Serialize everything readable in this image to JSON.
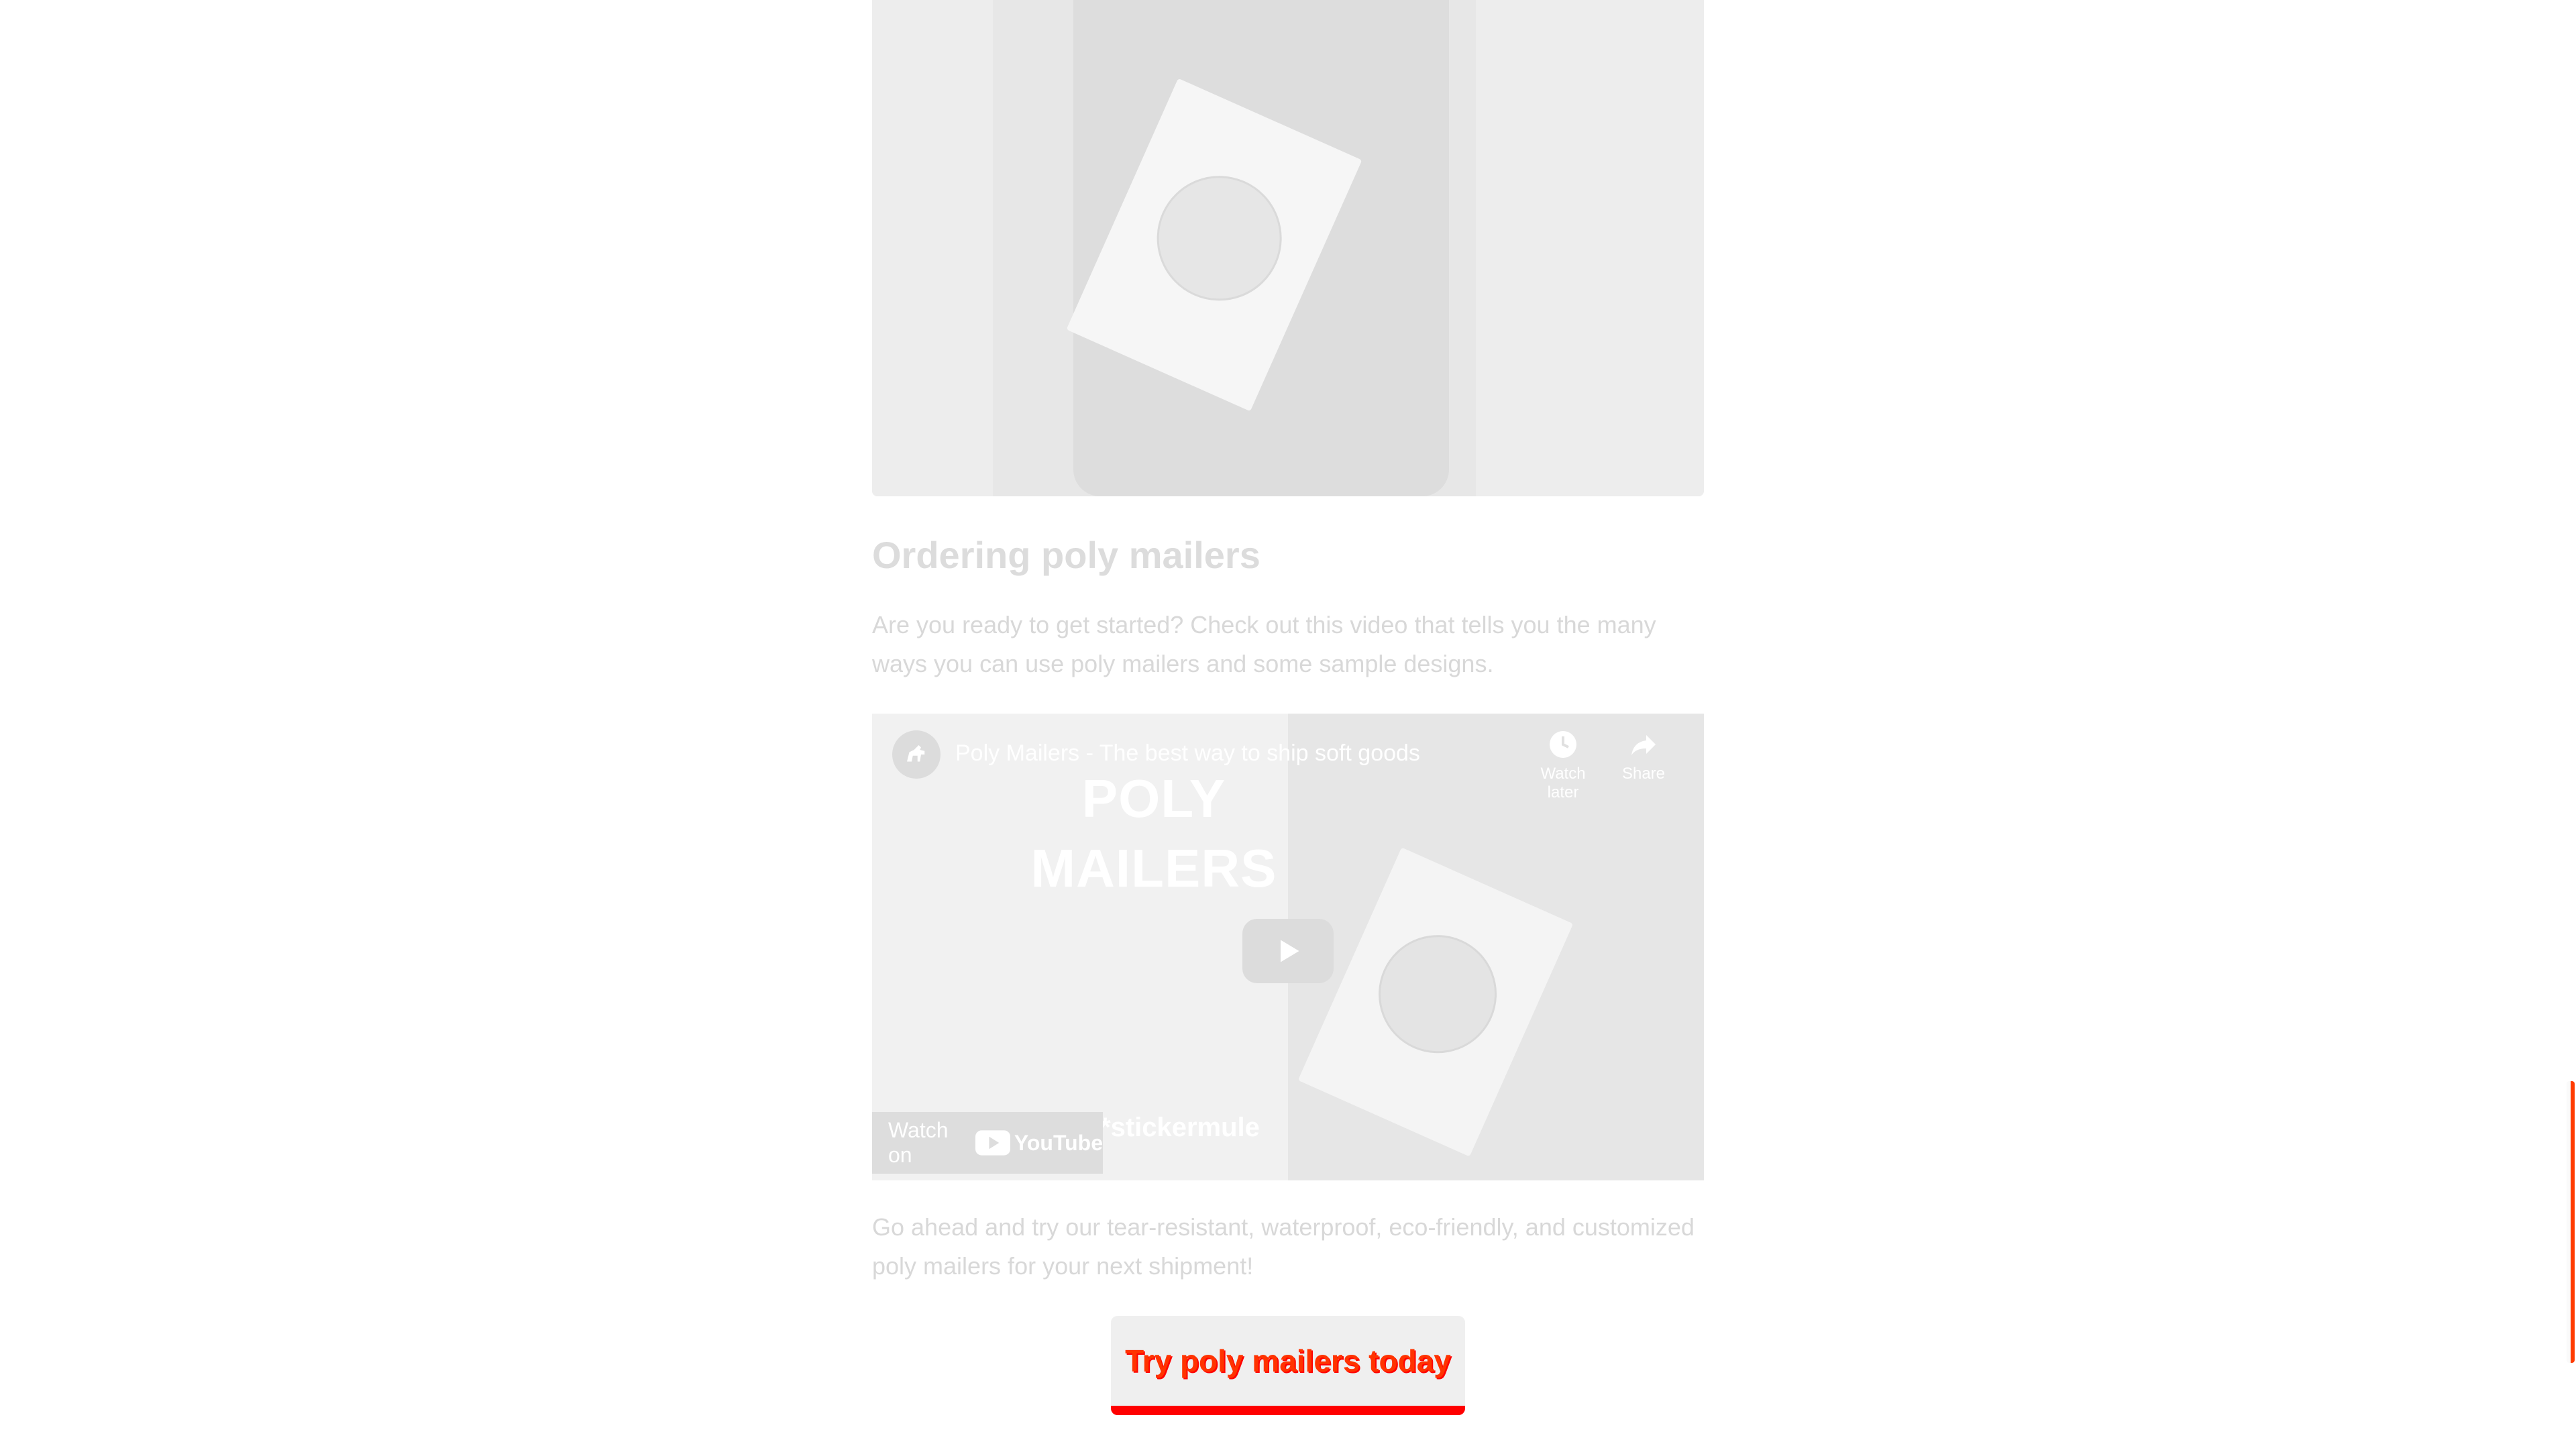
{
  "article": {
    "heading": "Ordering poly mailers",
    "intro": "Are you ready to get started? Check out this video that tells you the many ways you can use poly mailers and some sample designs.",
    "outro": "Go ahead and try our tear-resistant, waterproof, eco-friendly, and customized poly mailers for your next shipment!"
  },
  "video": {
    "title": "Poly Mailers - The best way to ship soft goods",
    "overlay_line1": "POLY",
    "overlay_line2": "MAILERS",
    "brand": "*stickermule",
    "watch_later": "Watch later",
    "share": "Share",
    "watch_on": "Watch on",
    "youtube": "YouTube",
    "icons": {
      "channel": "horse-logo-icon",
      "watch_later": "clock-icon",
      "share": "share-arrow-icon",
      "play": "play-icon",
      "youtube": "youtube-logo-icon"
    }
  },
  "cta": {
    "label": "Try poly mailers today"
  },
  "colors": {
    "accent": "#ff0000",
    "text_faded": "#d8d8d8"
  }
}
